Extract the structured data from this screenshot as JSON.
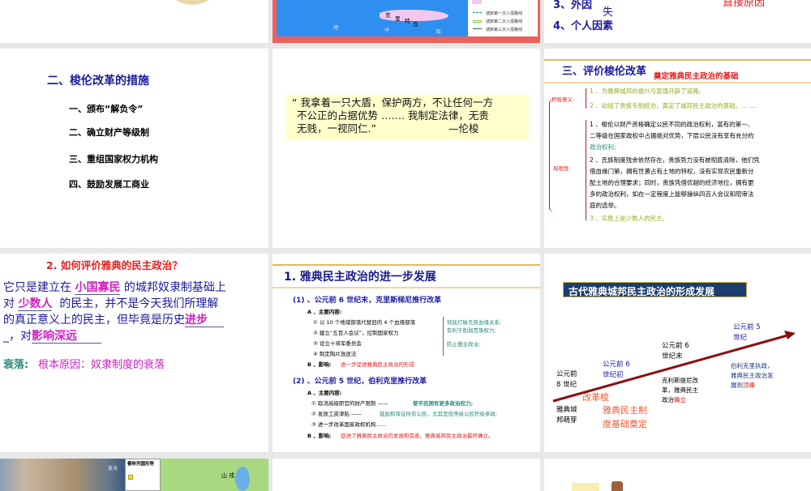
{
  "slides": {
    "r1c1": {},
    "r1c2": {
      "map_labels": [
        "克",
        "里",
        "特",
        "岛",
        "地",
        "中",
        "海"
      ],
      "legend": [
        "",
        "波斯第一次入侵路线",
        "波斯第二次入侵路线",
        "波斯第三次入侵路线"
      ]
    },
    "r1c3": {
      "item3": "3、外因",
      "fragment": "失",
      "item4": "4、个人因素",
      "red_note": "直接原因"
    },
    "r2c1": {
      "title": "二、梭伦改革的措施",
      "items": [
        "一、颁布“解负令”",
        "二、确立财产等级制",
        "三、重组国家权力机构",
        "四、鼓励发展工商业"
      ]
    },
    "r2c2": {
      "quote_l1": "“ 我拿着一只大盾，保护两方，不让任何一方",
      "quote_l2": "不公正的占据优势 ……. 我制定法律，无贵",
      "quote_l3": "无贱，一视同仁.”",
      "author": "—伦梭"
    },
    "r2c3": {
      "title": "三、评价梭伦改革",
      "subtitle": "奠定雅典民主政治的基础",
      "pos_label": "积极意义:",
      "neg_label": "局限性:",
      "pos": [
        "1 、为雅典城邦的振兴与富强开辟了道路;",
        "2 、动摇了贵族专制统治，奠定了城邦民主政治的基础。… …"
      ],
      "neg": [
        "1 、梭伦以财产资格确定公民不同的政治权利，富有的第一、",
        "二等级在国家政权中占据绝对优势，下层公民没有享有充分的",
        "政治权利;",
        "2 、氏族制度残余依然存在，贵族势力没有被彻底清除，他们凭",
        "借血缘门第，拥有世袭占有土地的特权，没有实现农民重新分",
        "配土地的合理要求；同时，贵族凭借优越的经济地位，拥有更",
        "多的政治权利，如在一定程度上能够操纵四百人会议和陪审法",
        "庭的选举。",
        "3 、实质上是少数人的民主。"
      ]
    },
    "r3c1": {
      "title": "2. 如何评价雅典的民主政治？",
      "l1a": "它只是建立在",
      "l1b": "小国寡民",
      "l1c": "的城邦奴隶制基础上",
      "l2a": "对",
      "l2b": "少数人",
      "l2c": "的民主，并不是今天我们所理解",
      "l3a": "的真正意义上的民主，但毕竟是历史",
      "l3b": "进步",
      "l4a": "_，对",
      "l4b": "影响深远",
      "decline_label": "衰落:",
      "decline_text": "根本原因：奴隶制度的衰落"
    },
    "r3c2": {
      "title": "1. 雅典民主政治的进一步发展",
      "h1": "(1) 、公元前 6 世纪末，克里斯梯尼推行改革",
      "a1": "A 、主要内容:",
      "i1": [
        "① 以  10 个地域部落代替旧的 4 个血缘部落",
        "② 建立“五百人会议”，控制国家权力",
        "③ 设立十将军委员会",
        "④ 制定陶片放逐法"
      ],
      "side1": [
        "彻底打破氏族血缘关系;",
        "有利于削弱贵族权力;",
        "防止僭主政治;"
      ],
      "b1_label": "B 、影响:",
      "b1": "进一步促进雅典民主政治的形成",
      "h2": "(2) 、公元前 5 世纪，伯利克里推行改革",
      "a2": "A 、主要内容:",
      "i2a": "① 取消高级职官的财产限制 ——",
      "i2a_note": "使平民拥有更多政治权力;",
      "i2b": "② 发放工资津贴 ——",
      "i2b_note": "鼓励和保证所有公民，尤其是低等级公民积极参政;",
      "i2c": "③ 进一步改革国家政权机构……",
      "b2_label": "B 、影响:",
      "b2": "促进了雅典民主政治的发展和完善，雅典城邦民主政治最终确立。"
    },
    "r3c3": {
      "title": "古代雅典城邦民主政治的形成发展",
      "t1": [
        "公元前",
        "8 世纪"
      ],
      "d1": [
        "雅典城",
        "邦萌芽"
      ],
      "t2": [
        "公元前 6",
        "世纪初"
      ],
      "reform": "改革梭",
      "d2": [
        "雅典民主制",
        "度基础奠定"
      ],
      "t3": [
        "公元前 6",
        "世纪末"
      ],
      "d3": [
        "克利斯提尼改",
        "革，雅典民主"
      ],
      "d3c": "政治",
      "d3r": "确立",
      "t4": [
        "公元前 5",
        "世纪"
      ],
      "d4": [
        "伯利克里执政，",
        "雅典民主政治发"
      ],
      "d4c": "展到",
      "d4r": "顶峰"
    },
    "r4c1": {
      "sea": "黄海",
      "legend_title": "春秋列国形势",
      "map_label": "山  戎"
    },
    "r4c2": {},
    "r4c3": {}
  },
  "colors": {
    "bg": "#e8e8e8",
    "title_blue": "#1a1a9c",
    "red": "#e02020",
    "rule": "#e8b860"
  }
}
